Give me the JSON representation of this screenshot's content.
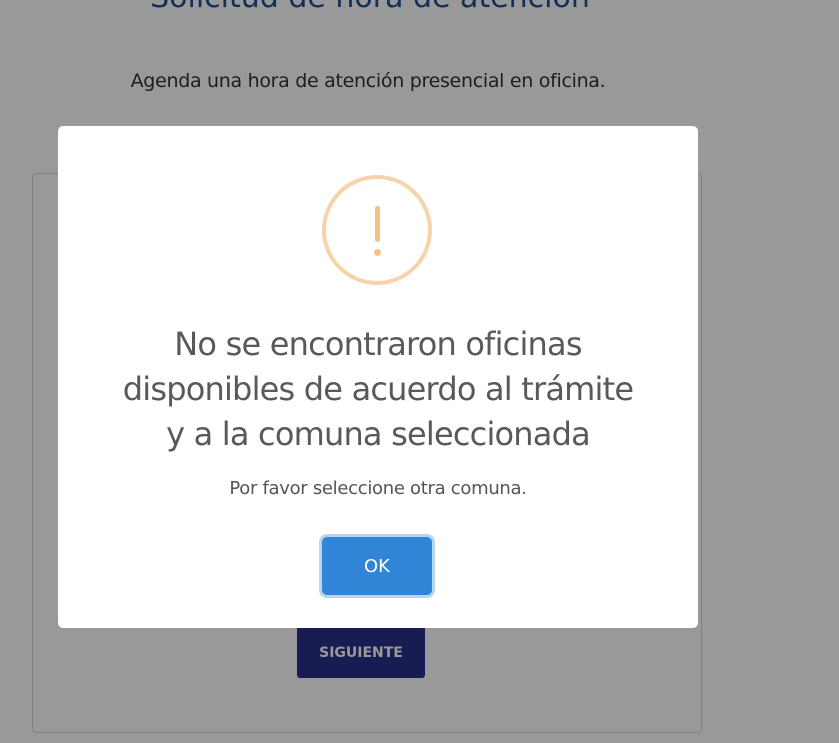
{
  "page": {
    "title": "Solicitud de hora de atención",
    "subtitle": "Agenda una hora de atención presencial en oficina.",
    "next_button_label": "SIGUIENTE"
  },
  "dialog": {
    "icon": "warning-icon",
    "title_line1": "No se encontraron oficinas",
    "title_line2": "disponibles de acuerdo al trámite",
    "title_line3": "y a la comuna seleccionada",
    "message": "Por favor seleccione otra comuna.",
    "ok_label": "OK"
  },
  "colors": {
    "page_title": "#1b4f95",
    "next_button": "#2b2e8a",
    "ok_button": "#3085d6",
    "warning_icon": "#f8bb86",
    "overlay": "rgba(0,0,0,0.4)"
  }
}
